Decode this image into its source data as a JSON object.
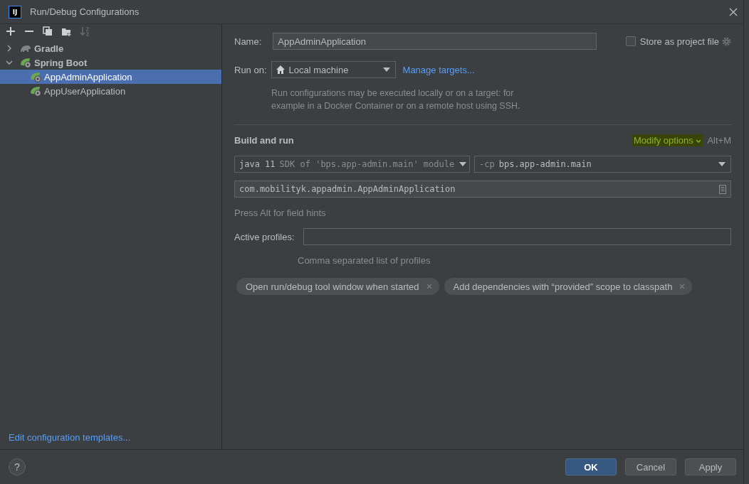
{
  "window": {
    "title": "Run/Debug Configurations",
    "logo": "IJ"
  },
  "toolbar": [
    {
      "kind": "add",
      "disabled": false
    },
    {
      "kind": "remove",
      "disabled": false
    },
    {
      "kind": "copy",
      "disabled": false
    },
    {
      "kind": "folder",
      "disabled": false
    },
    {
      "kind": "sort",
      "disabled": true
    }
  ],
  "tree": [
    {
      "label": "Gradle",
      "kind": "gradle",
      "expanded": false,
      "selected": false
    },
    {
      "label": "Spring Boot",
      "kind": "spring",
      "expanded": true,
      "selected": false,
      "children": [
        {
          "label": "AppAdminApplication",
          "kind": "app",
          "selected": true
        },
        {
          "label": "AppUserApplication",
          "kind": "app",
          "selected": false
        }
      ]
    }
  ],
  "edit_templates_link": "Edit configuration templates...",
  "form": {
    "name_label": "Name:",
    "name_value": "AppAdminApplication",
    "store_label": "Store as project file",
    "store_checked": false,
    "run_on_label": "Run on:",
    "run_on_value": "Local machine",
    "manage_targets_link": "Manage targets...",
    "run_on_description": "Run configurations may be executed locally or on a target: for example in a Docker Container or on a remote host using SSH.",
    "section_title": "Build and run",
    "modify_options": "Modify options",
    "modify_options_highlighted": true,
    "modify_shortcut": "Alt+M",
    "jdk_value": "java 11",
    "jdk_hint": "SDK of 'bps.app-admin.main' module",
    "classpath_prefix": "-cp",
    "classpath_value": "bps.app-admin.main",
    "main_class": "com.mobilityk.appadmin.AppAdminApplication",
    "field_hint": "Press Alt for field hints",
    "profiles_label": "Active profiles:",
    "profiles_help": "Comma separated list of profiles",
    "options": [
      "Open run/debug tool window when started",
      "Add dependencies with “provided” scope to classpath"
    ]
  },
  "help_button": "?",
  "buttons": [
    {
      "label": "OK",
      "default": true
    },
    {
      "label": "Cancel",
      "default": false
    },
    {
      "label": "Apply",
      "default": false
    }
  ]
}
